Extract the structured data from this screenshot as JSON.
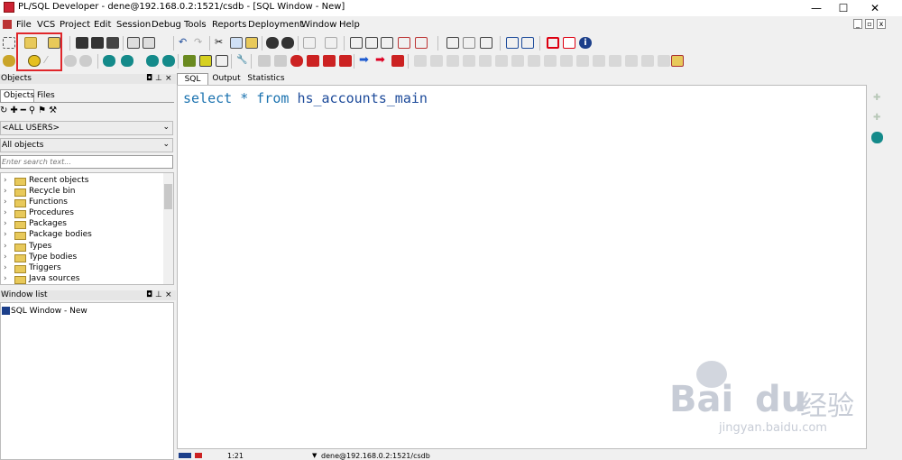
{
  "window": {
    "title": "PL/SQL Developer - dene@192.168.0.2:1521/csdb - [SQL Window - New]",
    "controls": {
      "minimize": "—",
      "maximize": "☐",
      "close": "✕"
    }
  },
  "menu": {
    "items": [
      "File",
      "VCS",
      "Project",
      "Edit",
      "Session",
      "Debug",
      "Tools",
      "Reports",
      "Deployment",
      "Window",
      "Help"
    ],
    "mdi_controls": [
      "_",
      "▫",
      "x"
    ]
  },
  "toolbar": {
    "highlight_color": "#e0262a"
  },
  "objects_panel": {
    "header": "Objects",
    "tabs": [
      "Objects",
      "Files"
    ],
    "owner_combo": "<ALL USERS>",
    "type_combo": "All objects",
    "search_placeholder": "Enter search text...",
    "tree_items": [
      "Recent objects",
      "Recycle bin",
      "Functions",
      "Procedures",
      "Packages",
      "Package bodies",
      "Types",
      "Type bodies",
      "Triggers",
      "Java sources"
    ]
  },
  "window_list": {
    "header": "Window list",
    "items": [
      "SQL Window - New"
    ]
  },
  "editor": {
    "tabs": [
      "SQL",
      "Output",
      "Statistics"
    ],
    "active_tab": "SQL",
    "sql": {
      "kw1": "select",
      "star": "*",
      "kw2": "from",
      "table": "hs_accounts_main"
    }
  },
  "status": {
    "position": "1:21",
    "connection": "dene@192.168.0.2:1521/csdb"
  },
  "watermark": {
    "brand": "Bai",
    "brand2": "du",
    "cn": "经验",
    "url": "jingyan.baidu.com"
  }
}
